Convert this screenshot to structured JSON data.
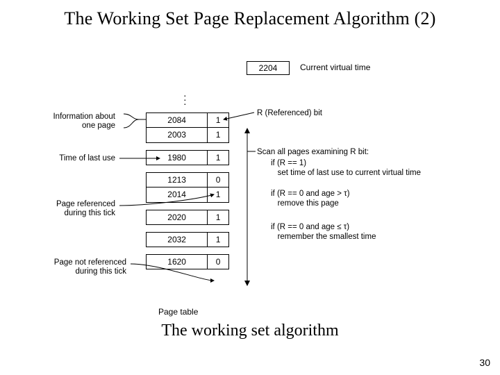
{
  "title": "The Working Set Page Replacement Algorithm (2)",
  "caption": "The working set algorithm",
  "page_number": "30",
  "current_virtual_time": {
    "value": "2204",
    "label": "Current virtual time"
  },
  "page_table_label": "Page table",
  "r_bit_label": "R (Referenced) bit",
  "rows": [
    {
      "time": "2084",
      "r": "1"
    },
    {
      "time": "2003",
      "r": "1"
    },
    {
      "time": "1980",
      "r": "1"
    },
    {
      "time": "1213",
      "r": "0"
    },
    {
      "time": "2014",
      "r": "1"
    },
    {
      "time": "2020",
      "r": "1"
    },
    {
      "time": "2032",
      "r": "1"
    },
    {
      "time": "1620",
      "r": "0"
    }
  ],
  "left_annotations": {
    "info": "Information about\none page",
    "time_last_use": "Time of last use",
    "page_ref": "Page referenced\nduring this tick",
    "page_not_ref": "Page not referenced\nduring this tick"
  },
  "right_block": {
    "scan_header": "Scan all pages examining R bit:",
    "case1a": "if (R == 1)",
    "case1b": "   set time of last use to current virtual time",
    "case2a": "if (R == 0 and age > τ)",
    "case2b": "   remove this page",
    "case3a": "if (R == 0 and age ≤ τ)",
    "case3b": "   remember the smallest time"
  }
}
